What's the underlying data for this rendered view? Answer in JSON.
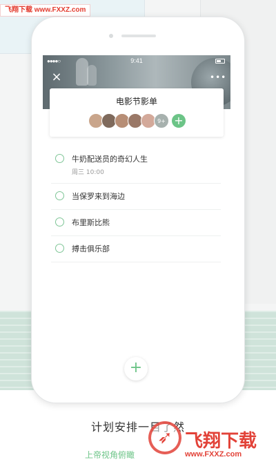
{
  "watermark": {
    "top_text": "飞翔下载 www.FXXZ.com",
    "brand": "飞翔下载",
    "url": "www.FXXZ.com",
    "color": "#e24238"
  },
  "statusbar": {
    "time": "9:41"
  },
  "list": {
    "title": "电影节影单",
    "member_overflow": "9+",
    "members": [
      {
        "color": "#c9a58b"
      },
      {
        "color": "#7f6a5c"
      },
      {
        "color": "#b78e76"
      },
      {
        "color": "#9a7867"
      },
      {
        "color": "#d3a99a"
      }
    ]
  },
  "tasks": [
    {
      "title": "牛奶配送员的奇幻人生",
      "subtitle": "周三  10:00"
    },
    {
      "title": "当保罗来到海边",
      "subtitle": ""
    },
    {
      "title": "布里斯比熊",
      "subtitle": ""
    },
    {
      "title": "搏击俱乐部",
      "subtitle": ""
    }
  ],
  "caption": {
    "title": "计划安排一目了然",
    "subtitle": "上帝视角俯瞰"
  },
  "colors": {
    "accent": "#6cc487",
    "wave_band": "#cfe3da"
  }
}
